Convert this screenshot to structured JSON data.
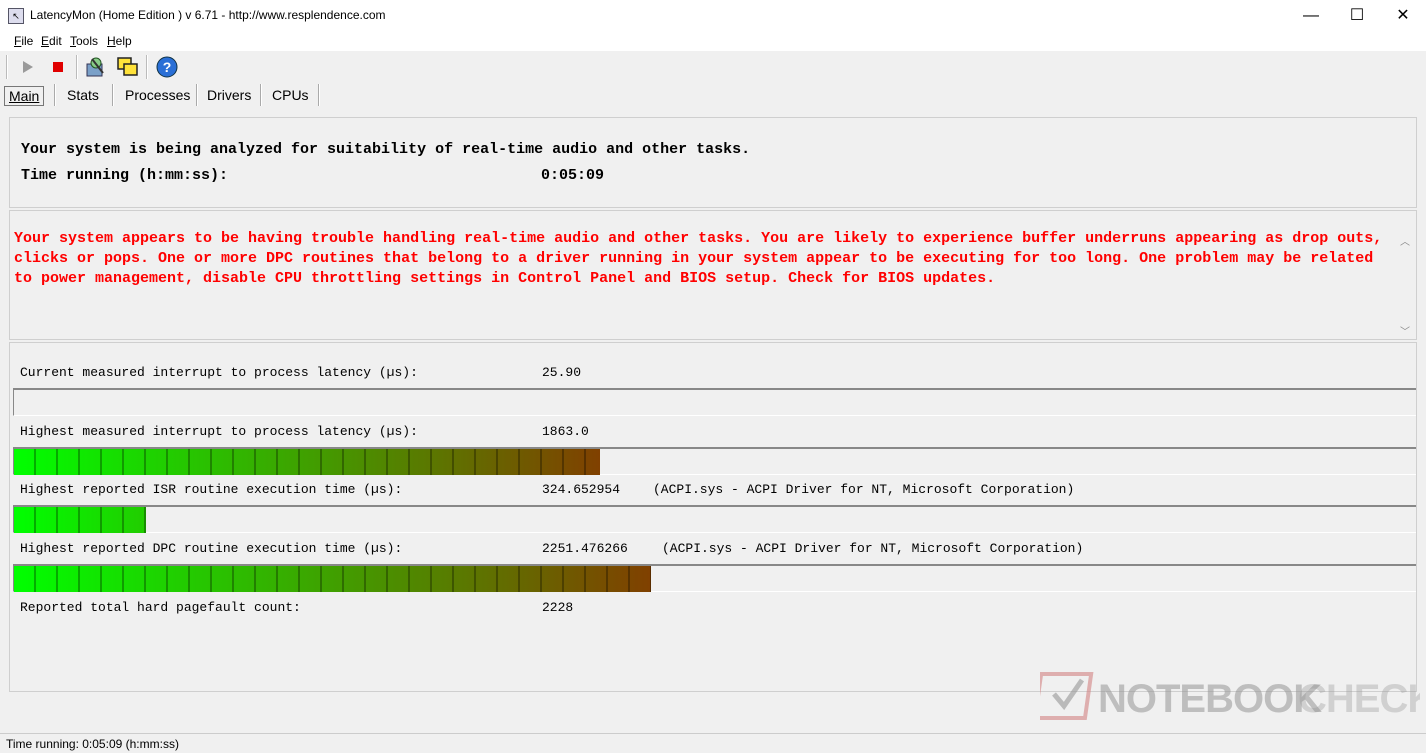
{
  "window": {
    "title": "LatencyMon  (Home Edition )  v 6.71 - http://www.resplendence.com",
    "minimize": "—",
    "maximize": "☐",
    "close": "✕"
  },
  "menu": {
    "file": {
      "underline": "F",
      "rest": "ile"
    },
    "edit": {
      "underline": "E",
      "rest": "dit"
    },
    "tools": {
      "underline": "T",
      "rest": "ools"
    },
    "help": {
      "underline": "H",
      "rest": "elp"
    }
  },
  "toolbar": {
    "play_icon": "play-icon",
    "stop_icon": "stop-icon",
    "analyze_icon": "analyze-icon",
    "windows_icon": "windows-icon",
    "help_icon": "help-icon"
  },
  "tabs": [
    {
      "label": "Main",
      "active": true
    },
    {
      "label": "Stats",
      "active": false
    },
    {
      "label": "Processes",
      "active": false
    },
    {
      "label": "Drivers",
      "active": false
    },
    {
      "label": "CPUs",
      "active": false
    }
  ],
  "status": {
    "line1": "Your system is being analyzed for suitability of real-time audio and other tasks.",
    "time_label": "Time running (h:mm:ss):",
    "time_value": "0:05:09"
  },
  "warning": {
    "text": "Your system appears to be having trouble handling real-time audio and other tasks. You are likely to experience buffer underruns appearing as drop outs, clicks or pops. One or more DPC routines that belong to a driver running in your system appear to be executing for too long. One problem may be related to power management, disable CPU throttling settings in Control Panel and BIOS setup. Check for BIOS updates.",
    "color": "#ff0000"
  },
  "metrics": {
    "current_label": "Current measured interrupt to process latency (µs):",
    "current_value": "25.90",
    "current_fill": 0.0,
    "highest_label": "Highest measured interrupt to process latency (µs):",
    "highest_value": "1863.0",
    "highest_fill": 0.418,
    "isr_label": "Highest reported ISR routine execution time (µs):",
    "isr_value": "324.652954",
    "isr_driver": "(ACPI.sys - ACPI Driver for NT, Microsoft Corporation)",
    "isr_fill": 0.094,
    "dpc_label": "Highest reported DPC routine execution time (µs):",
    "dpc_value": "2251.476266",
    "dpc_driver": "(ACPI.sys - ACPI Driver for NT, Microsoft Corporation)",
    "dpc_fill": 0.454,
    "pagefault_label": "Reported total hard pagefault count:",
    "pagefault_value": "2228"
  },
  "bar_colors": {
    "start": "#00ff00",
    "end": "#804000"
  },
  "statusbar": {
    "text": "Time running: 0:05:09  (h:mm:ss)"
  },
  "watermark": {
    "text": "NOTEBOOKCHECK"
  }
}
